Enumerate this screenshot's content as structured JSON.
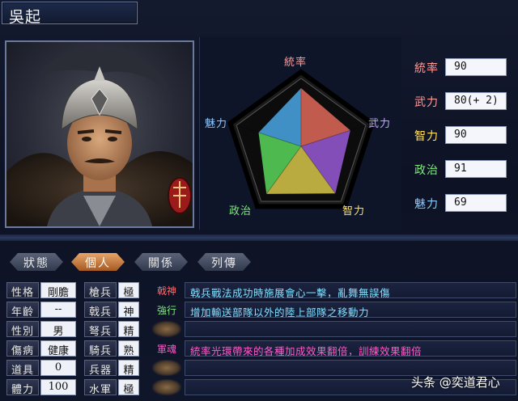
{
  "header": {
    "name": "吳起"
  },
  "radar": {
    "labels": {
      "top": "統率",
      "right": "武力",
      "bottom_right": "智力",
      "bottom_left": "政治",
      "left": "魅力"
    },
    "label_colors": {
      "top": "#ff9a9a",
      "right": "#c6a8ff",
      "bottom_right": "#ffe066",
      "bottom_left": "#7fe87f",
      "left": "#8ec8ff"
    },
    "values": {
      "統率": 90,
      "武力": 80,
      "智力": 90,
      "政治": 91,
      "魅力": 69
    }
  },
  "stats": [
    {
      "label": "統率",
      "value": "90",
      "color": "#ff9a9a"
    },
    {
      "label": "武力",
      "value": "80(+ 2)",
      "color": "#ff9a9a"
    },
    {
      "label": "智力",
      "value": "90",
      "color": "#ffe066"
    },
    {
      "label": "政治",
      "value": "91",
      "color": "#7fe87f"
    },
    {
      "label": "魅力",
      "value": "69",
      "color": "#8ec8ff"
    }
  ],
  "tabs": [
    {
      "label": "狀態",
      "active": false
    },
    {
      "label": "個人",
      "active": true
    },
    {
      "label": "關係",
      "active": false
    },
    {
      "label": "列傳",
      "active": false
    }
  ],
  "attributes": [
    {
      "l1": "性格",
      "v1": "剛膽",
      "l2": "槍兵",
      "v2": "極"
    },
    {
      "l1": "年齡",
      "v1": "--",
      "l2": "戟兵",
      "v2": "神"
    },
    {
      "l1": "性別",
      "v1": "男",
      "l2": "弩兵",
      "v2": "精"
    },
    {
      "l1": "傷病",
      "v1": "健康",
      "l2": "騎兵",
      "v2": "熟"
    },
    {
      "l1": "道具",
      "v1": "0",
      "l2": "兵器",
      "v2": "精"
    },
    {
      "l1": "體力",
      "v1": "100",
      "l2": "水軍",
      "v2": "極"
    }
  ],
  "skills": [
    {
      "tag": "戟神",
      "desc": "戟兵戰法成功時施展會心一擊，亂舞無誤傷",
      "tag_color": "#ff6b6b",
      "desc_color": "#7fe0ff"
    },
    {
      "tag": "強行",
      "desc": "增加輸送部隊以外的陸上部隊之移動力",
      "tag_color": "#7fe87f",
      "desc_color": "#7fe0ff"
    },
    {
      "tag": "",
      "desc": "",
      "tag_color": "",
      "desc_color": ""
    },
    {
      "tag": "軍魂",
      "desc": "統率光環帶來的各種加成效果翻倍，訓練效果翻倍",
      "tag_color": "#ff5ac8",
      "desc_color": "#ff5ac8"
    },
    {
      "tag": "",
      "desc": "",
      "tag_color": "",
      "desc_color": ""
    },
    {
      "tag": "",
      "desc": "",
      "tag_color": "",
      "desc_color": ""
    }
  ],
  "watermark": "头条 @奕道君心"
}
